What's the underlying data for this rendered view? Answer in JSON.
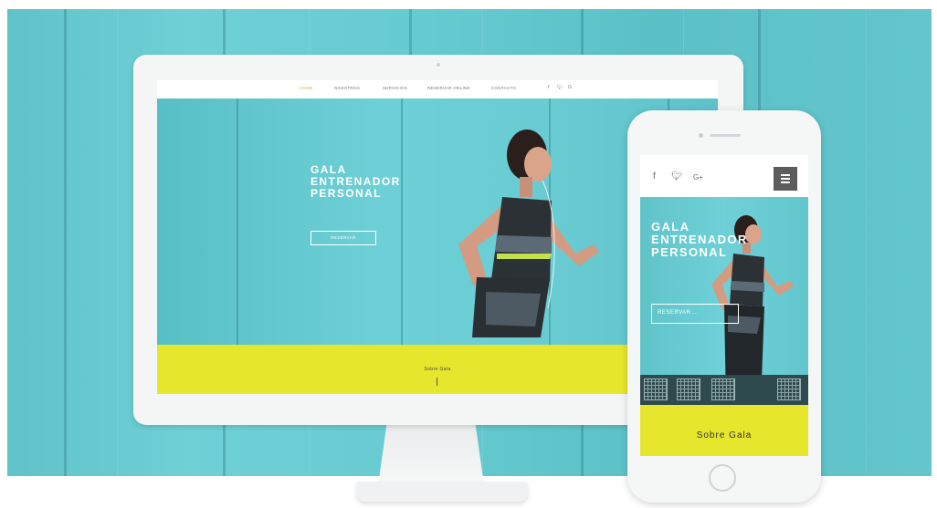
{
  "desktop": {
    "nav": {
      "items": [
        "HOME",
        "NOSOTROS",
        "SERVICIOS",
        "RESERVAR ONLINE",
        "CONTACTO"
      ],
      "social_icons": [
        "facebook-icon",
        "twitter-icon",
        "google-plus-icon"
      ]
    },
    "hero": {
      "title": "GALA\nENTRENADOR\nPERSONAL",
      "button_label": "RESERVAR"
    },
    "about_label": "Sobre Gala"
  },
  "mobile": {
    "social_icons": [
      "facebook-icon",
      "twitter-icon",
      "google-plus-icon"
    ],
    "menu_icon": "hamburger-menu-icon",
    "hero": {
      "title": "GALA\nENTRENADOR\nPERSONAL",
      "button_label": "RESERVAR ..."
    },
    "about_label": "Sobre Gala"
  },
  "colors": {
    "wall_teal": "#64c8ce",
    "accent_yellow": "#e6e62c",
    "nav_active": "#d9b93c",
    "device_white": "#f4f5f5",
    "menu_button": "#5c5c5c"
  }
}
